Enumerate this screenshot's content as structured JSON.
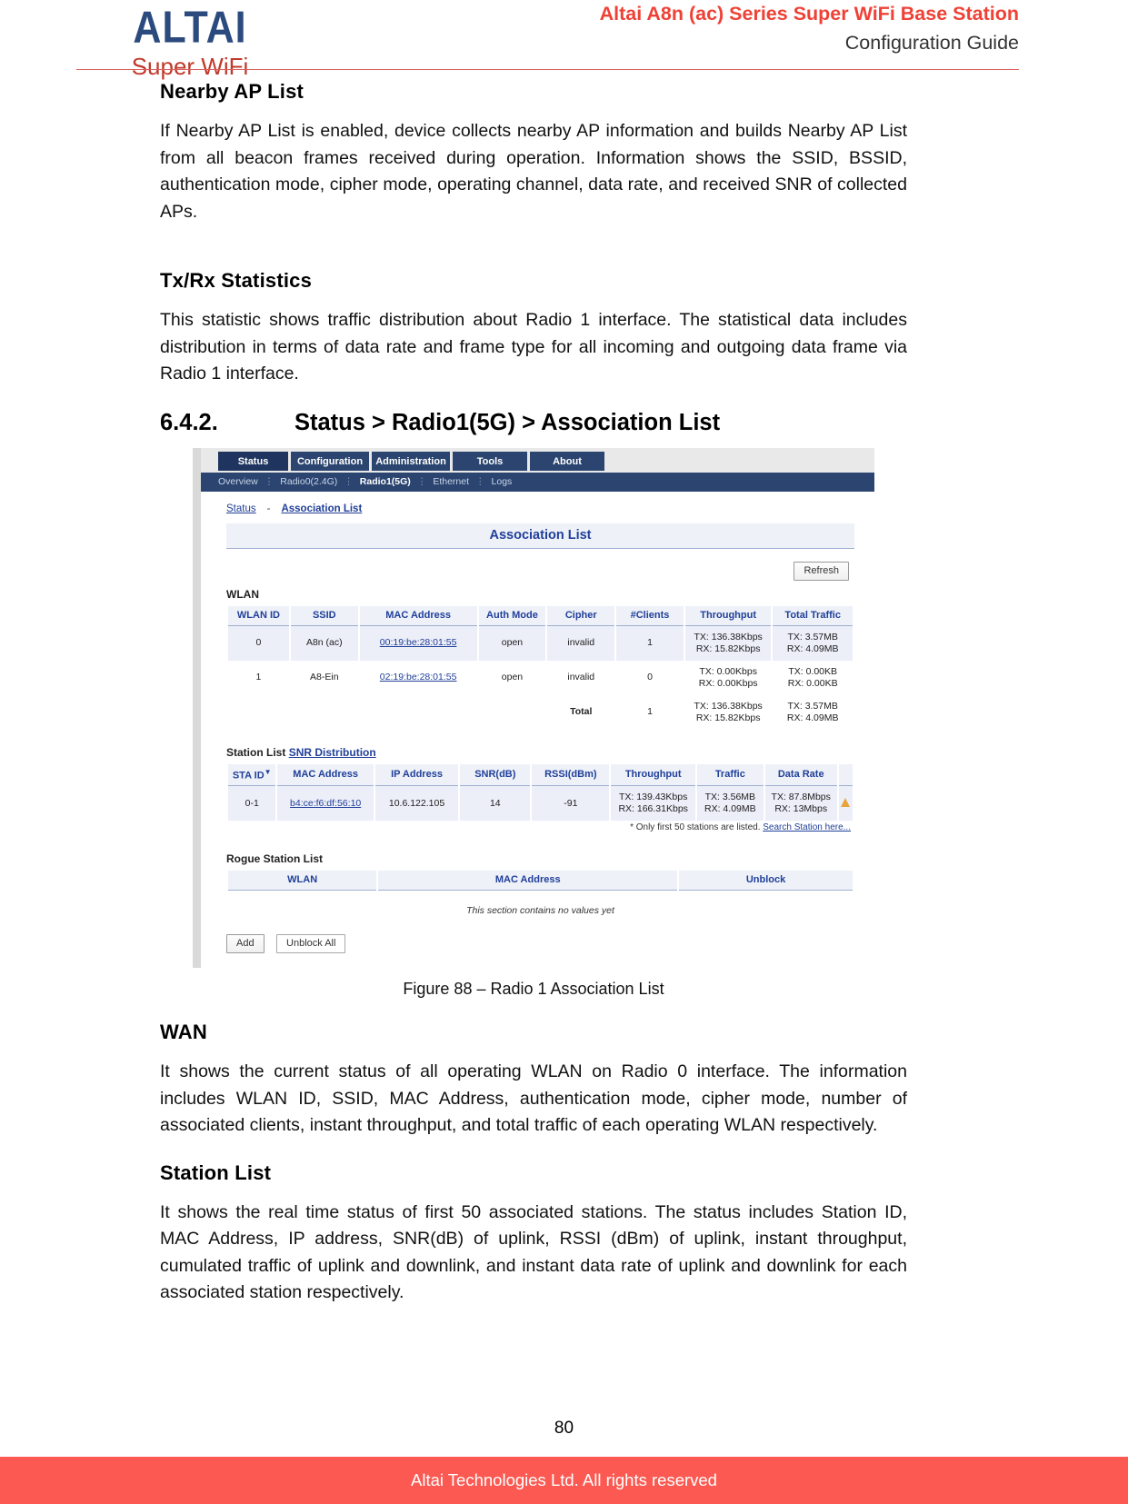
{
  "header": {
    "logo_main": "ALTAI",
    "logo_sub": "Super WiFi",
    "title": "Altai A8n (ac) Series Super WiFi Base Station",
    "subtitle": "Configuration Guide"
  },
  "sections": {
    "nearby_ap_heading": "Nearby AP List",
    "nearby_ap_paragraph": "If Nearby AP List is enabled, device collects nearby AP information and builds Nearby AP List from all beacon frames received during operation. Information shows the SSID, BSSID, authentication mode, cipher mode, operating channel, data rate, and received SNR of collected APs.",
    "txrx_heading": "Tx/Rx Statistics",
    "txrx_paragraph": "This statistic shows traffic distribution about Radio 1 interface. The statistical data includes distribution in terms of data rate and frame type for all incoming and outgoing data frame via Radio 1 interface.",
    "numbered_heading_number": "6.4.2.",
    "numbered_heading_text": "Status > Radio1(5G) > Association List",
    "wan_heading": "WAN",
    "wan_paragraph": "It shows the current status of all operating WLAN on Radio 0 interface. The information includes WLAN ID, SSID, MAC Address, authentication mode, cipher mode, number of associated clients, instant throughput, and total traffic of each operating WLAN respectively.",
    "station_list_heading": "Station List",
    "station_list_paragraph": "It shows the real time status of first 50 associated stations. The status includes Station ID, MAC Address, IP address, SNR(dB) of uplink, RSSI (dBm) of uplink, instant throughput, cumulated traffic of uplink and downlink, and instant data rate of uplink and downlink for each associated station respectively."
  },
  "figure": {
    "caption": "Figure 88 – Radio 1 Association List",
    "tabs": [
      {
        "label": "Status",
        "active": true
      },
      {
        "label": "Configuration",
        "active": false
      },
      {
        "label": "Administration",
        "active": false
      },
      {
        "label": "Tools",
        "active": false
      },
      {
        "label": "About",
        "active": false
      }
    ],
    "subtabs": [
      {
        "label": "Overview",
        "active": false
      },
      {
        "label": "Radio0(2.4G)",
        "active": false
      },
      {
        "label": "Radio1(5G)",
        "active": true
      },
      {
        "label": "Ethernet",
        "active": false
      },
      {
        "label": "Logs",
        "active": false
      }
    ],
    "breadcrumb": {
      "root": "Status",
      "dash": "-",
      "current": "Association List"
    },
    "panel_title": "Association List",
    "refresh_button": "Refresh",
    "wlan_label": "WLAN",
    "wlan_table": {
      "headers": [
        "WLAN ID",
        "SSID",
        "MAC Address",
        "Auth Mode",
        "Cipher",
        "#Clients",
        "Throughput",
        "Total Traffic"
      ],
      "rows": [
        {
          "wlan_id": "0",
          "ssid": "A8n (ac)",
          "mac": "00:19:be:28:01:55",
          "auth": "open",
          "cipher": "invalid",
          "clients": "1",
          "tp_tx": "TX: 136.38Kbps",
          "tp_rx": "RX: 15.82Kbps",
          "tt_tx": "TX: 3.57MB",
          "tt_rx": "RX: 4.09MB"
        },
        {
          "wlan_id": "1",
          "ssid": "A8-Ein",
          "mac": "02:19:be:28:01:55",
          "auth": "open",
          "cipher": "invalid",
          "clients": "0",
          "tp_tx": "TX: 0.00Kbps",
          "tp_rx": "RX: 0.00Kbps",
          "tt_tx": "TX: 0.00KB",
          "tt_rx": "RX: 0.00KB"
        }
      ],
      "total_row": {
        "label": "Total",
        "clients": "1",
        "tp_tx": "TX: 136.38Kbps",
        "tp_rx": "RX: 15.82Kbps",
        "tt_tx": "TX: 3.57MB",
        "tt_rx": "RX: 4.09MB"
      }
    },
    "station_section_label": "Station List",
    "snr_distribution_link": "SNR Distribution",
    "station_table": {
      "headers": [
        "STA ID",
        "MAC Address",
        "IP Address",
        "SNR(dB)",
        "RSSI(dBm)",
        "Throughput",
        "Traffic",
        "Data Rate"
      ],
      "sort_indicator": "▼",
      "rows": [
        {
          "sta_id": "0-1",
          "mac": "b4:ce:f6:df:56:10",
          "ip": "10.6.122.105",
          "snr": "14",
          "rssi": "-91",
          "tp_tx": "TX: 139.43Kbps",
          "tp_rx": "RX: 166.31Kbps",
          "tr_tx": "TX: 3.56MB",
          "tr_rx": "RX: 4.09MB",
          "dr_tx": "TX: 87.8Mbps",
          "dr_rx": "RX: 13Mbps",
          "status_icon": "warning-triangle-icon"
        }
      ],
      "footnote_text": "* Only first 50 stations are listed.",
      "footnote_link": "Search Station here..."
    },
    "rogue_section_label": "Rogue Station List",
    "rogue_table": {
      "headers": [
        "WLAN",
        "MAC Address",
        "Unblock"
      ],
      "empty_message": "This section contains no values yet"
    },
    "buttons": {
      "add": "Add",
      "unblock_all": "Unblock All"
    }
  },
  "footer": {
    "page_number": "80",
    "copyright": "Altai Technologies Ltd. All rights reserved"
  }
}
